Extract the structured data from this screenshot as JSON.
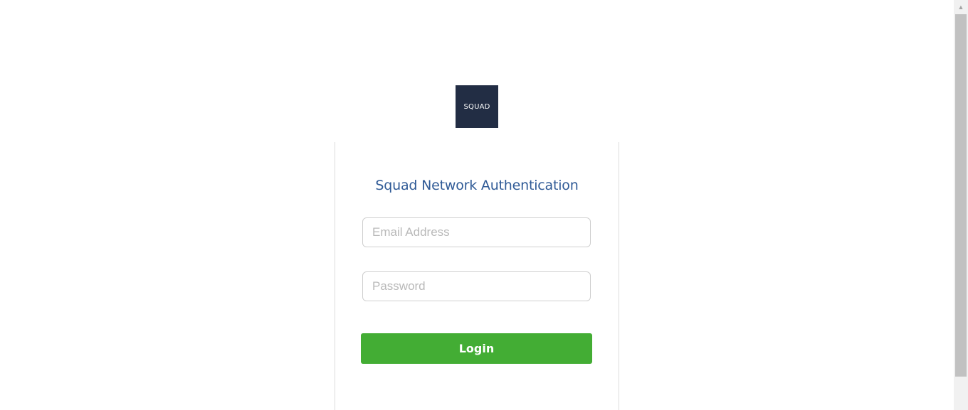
{
  "logo": {
    "text": "SQUAD"
  },
  "form": {
    "title": "Squad Network Authentication",
    "email": {
      "placeholder": "Email Address",
      "value": ""
    },
    "password": {
      "placeholder": "Password",
      "value": ""
    },
    "login_label": "Login"
  },
  "colors": {
    "logo_bg": "#222d44",
    "title": "#2f5a96",
    "login_button": "#43ad34"
  },
  "icons": {
    "scroll_up": "scroll-up-arrow-icon"
  }
}
